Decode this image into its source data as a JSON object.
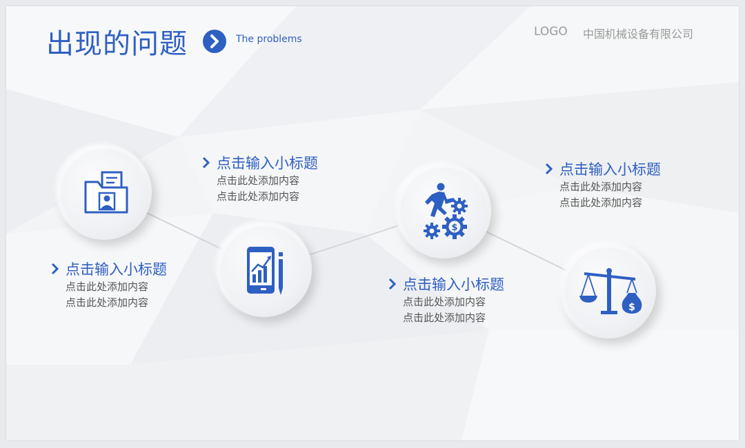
{
  "header": {
    "title": "出现的问题",
    "subtitle": "The problems",
    "logo": "LOGO",
    "company": "中国机械设备有限公司"
  },
  "colors": {
    "accent": "#2e5fc2",
    "text_gray": "#555555",
    "header_gray": "#9a9a9a"
  },
  "items": [
    {
      "title": "点击输入小标题",
      "line1": "点击此处添加内容",
      "line2": "点击此处添加内容",
      "icon": "folder-profile-icon"
    },
    {
      "title": "点击输入小标题",
      "line1": "点击此处添加内容",
      "line2": "点击此处添加内容",
      "icon": "tablet-chart-pen-icon"
    },
    {
      "title": "点击输入小标题",
      "line1": "点击此处添加内容",
      "line2": "点击此处添加内容",
      "icon": "runner-gears-dollar-icon"
    },
    {
      "title": "点击输入小标题",
      "line1": "点击此处添加内容",
      "line2": "点击此处添加内容",
      "icon": "balance-scale-money-icon"
    }
  ]
}
